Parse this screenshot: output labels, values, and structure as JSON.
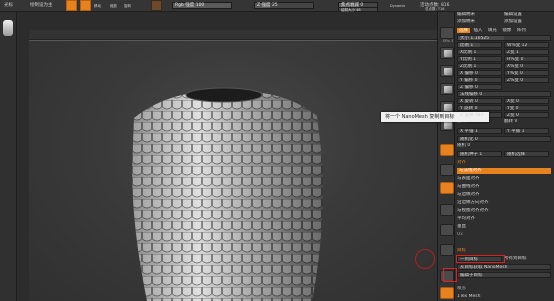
{
  "topbar": {
    "left_label": "光标",
    "left_sub": "绘制设为主",
    "rgb_label": "Rgb 强度 100",
    "z_label": "Z 强度 25",
    "focal_label": "焦点衰减 0",
    "draw_size_label": "绘制大小 46",
    "dynamic_label": "Dynamic",
    "active_points": "活动点数: 816",
    "total_points": "总点数: 716"
  },
  "tooltip": "将一个 NanoMesh 复制到目标",
  "panel": {
    "top_row_a": "编辑纳米",
    "top_row_b": "编辑设置",
    "top_row_c": "添加纳米",
    "top_row_d": "添加设置",
    "tabs": [
      "选择",
      "插入",
      "填充",
      "镜像",
      "阵列"
    ],
    "rows": [
      "大小 1.10525",
      "比例 1",
      "X比例 1",
      "Y比例 1",
      "Z比例 1",
      "X 偏移 0",
      "Y 偏移 0",
      "Z 偏移 0",
      "法线偏移 0",
      "X 旋转 0",
      "Y 旋转 0",
      "Z 旋转 180",
      "翻转 H",
      "X 平铺 1",
      "随机化 0",
      "随机 0",
      "随机种子 1"
    ],
    "rows_right": [
      "W%变 12",
      "Z变 1",
      "H%变 0",
      "X%变 0",
      "Y%变 0",
      "Z%变 0",
      "X变 0",
      "Y变 0",
      "Z变 0",
      "翻转 V",
      "Y 平铺 1"
    ],
    "random_btn": "随机选择",
    "section_align": "对齐",
    "align_rows": [
      "与法线对齐",
      "与表面对齐",
      "与曲线对齐",
      "与边缘对齐",
      "沿边缘方向对齐",
      "与视图对齐对齐",
      "平均对齐",
      "垂直",
      "Ux"
    ],
    "section_target": "目标",
    "copy_btn": "一到目标",
    "copy_btn_right": "所有到目标",
    "from_target": "从目标获取 NanoMesh",
    "edit_target": "编辑子目标",
    "bottom_label": "覆盖",
    "bottom_label2": "1Tex Mesh"
  },
  "rtools": {
    "labels": [
      "SPix 3",
      "透视",
      "地面",
      "Local",
      "Fill",
      "Frame",
      "Move",
      "Rotate",
      "AAHalf",
      "Transp"
    ]
  }
}
